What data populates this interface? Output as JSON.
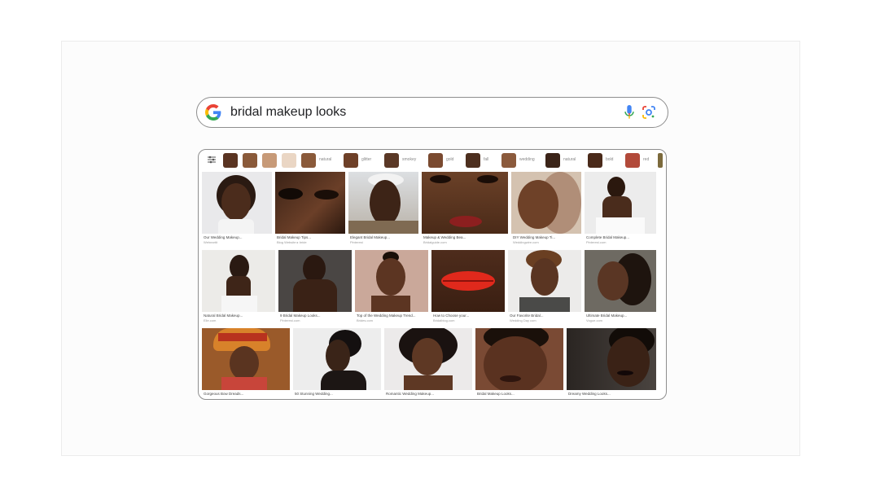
{
  "search": {
    "query": "bridal makeup looks"
  },
  "icons": {
    "google": "google-g-icon",
    "mic": "microphone-icon",
    "lens": "google-lens-icon",
    "filter": "tune-filter-icon"
  },
  "chips": [
    {
      "label": "natural",
      "color": "#8a5a3a"
    },
    {
      "label": "glitter",
      "color": "#6e4028"
    },
    {
      "label": "smokey",
      "color": "#5a3826"
    },
    {
      "label": "gold",
      "color": "#7a4a30"
    },
    {
      "label": "fall",
      "color": "#4d2f1f"
    },
    {
      "label": "wedding",
      "color": "#8b5a3c"
    },
    {
      "label": "natural",
      "color": "#3b2418"
    },
    {
      "label": "bold",
      "color": "#4a2a1a"
    },
    {
      "label": "red",
      "color": "#b24a3a"
    }
  ],
  "swatches": [
    "#5a3422",
    "#8a5a3a",
    "#c79a78",
    "#ead6c4"
  ],
  "results": {
    "row1": [
      {
        "caption": "Our Wedding Makeup...",
        "source": "Weheartit"
      },
      {
        "caption": "Bridal Makeup Tips...",
        "source": "Blog Website ▸ bride"
      },
      {
        "caption": "Elegant Bridal Makeup...",
        "source": "Pinterest"
      },
      {
        "caption": "Makeup & Wedding Bea...",
        "source": "Bridalguide.com"
      },
      {
        "caption": "DIY Wedding Makeup Ti...",
        "source": "Weddingwire.com"
      },
      {
        "caption": "Complete Bridal Makeup...",
        "source": "Pinterest.com"
      }
    ],
    "row2": [
      {
        "caption": "Natural Bridal Makeup...",
        "source": "Elle.com"
      },
      {
        "caption": "9 Bridal Makeup Looks...",
        "source": "Pinterest.com"
      },
      {
        "caption": "Top of the Wedding Makeup Trend...",
        "source": "Brides.com"
      },
      {
        "caption": "How to Choose your...",
        "source": "Bridalblog.com"
      },
      {
        "caption": "Our Favorite Bridal...",
        "source": "Wedding Day com"
      },
      {
        "caption": "Ultimate Bridal Makeup...",
        "source": "Vogue.com"
      }
    ],
    "row3": [
      {
        "caption": "Gorgeous Bow Dreads..."
      },
      {
        "caption": "50 Stunning Wedding..."
      },
      {
        "caption": "Romantic Wedding Makeup..."
      },
      {
        "caption": "Bridal Makeup Looks..."
      },
      {
        "caption": "Dreamy Wedding Looks..."
      }
    ]
  }
}
